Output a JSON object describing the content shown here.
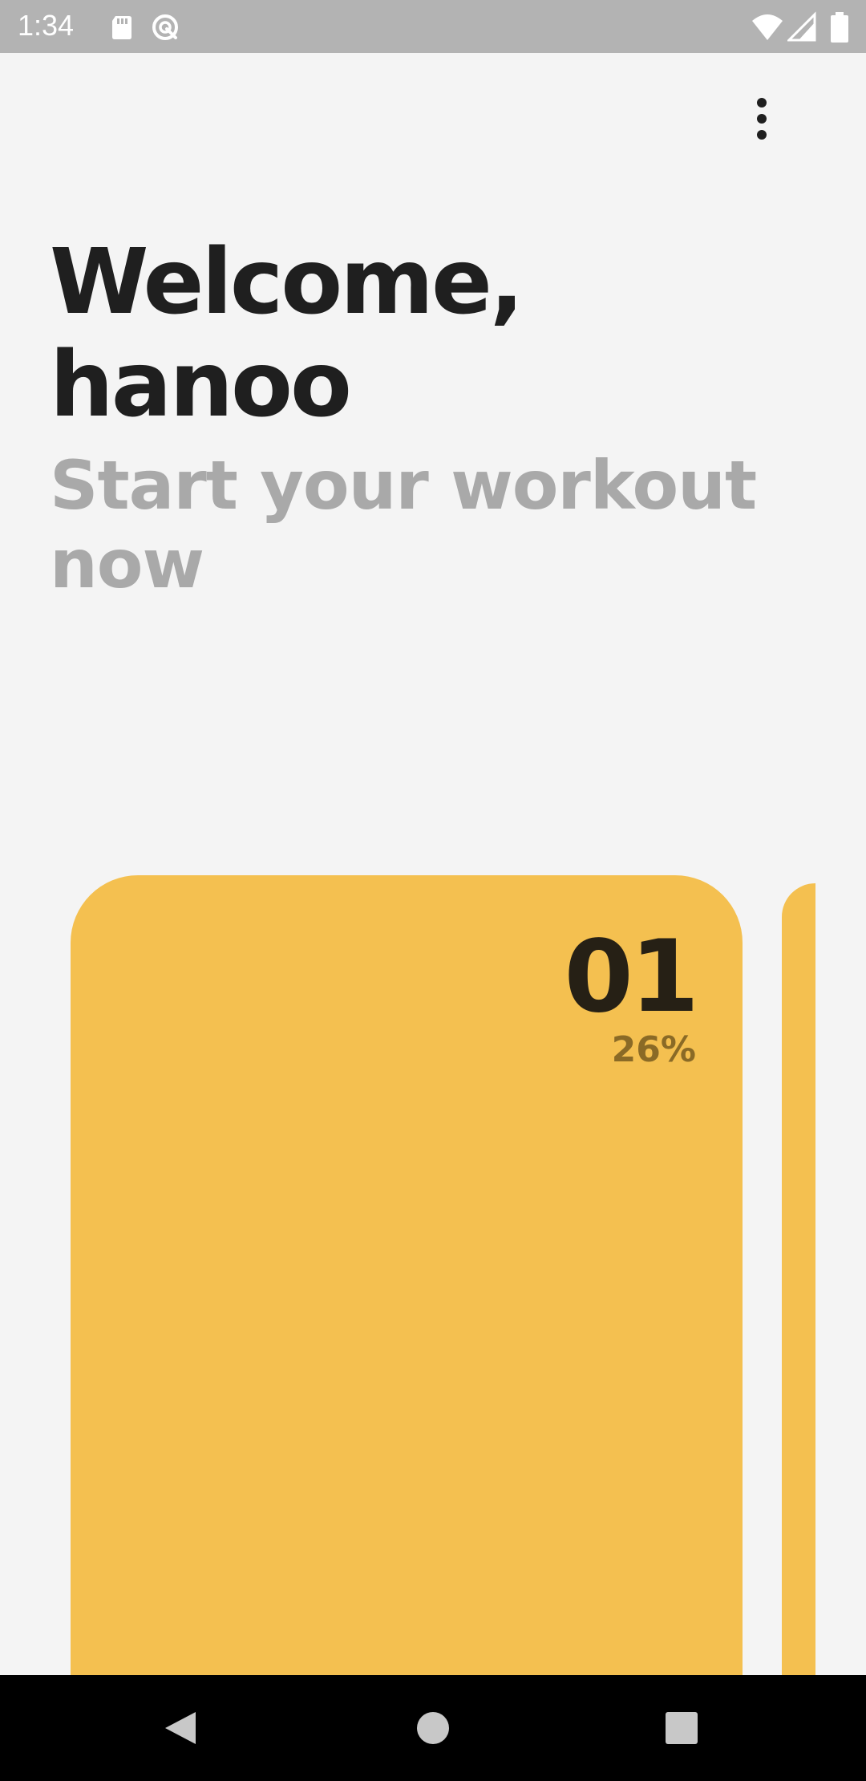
{
  "status_bar": {
    "time": "1:34",
    "background": "#b3b3b3",
    "icons_left": [
      "sd-card-icon",
      "sync-disabled-icon"
    ],
    "icons_right": [
      "wifi-icon",
      "cell-signal-icon",
      "battery-icon"
    ]
  },
  "menu": {
    "icon": "more-vert-icon"
  },
  "header": {
    "welcome": "Welcome, hanoo",
    "subtitle": "Start your workout now"
  },
  "workouts": [
    {
      "number": "01",
      "progress": "26%",
      "color": "#f4c050"
    }
  ],
  "colors": {
    "background": "#f4f4f4",
    "accent": "#f4c050",
    "title": "#1f1f1f",
    "subtitle": "#a9a9a9"
  },
  "nav_bar": {
    "buttons": [
      "back-icon",
      "home-icon",
      "recents-icon"
    ]
  }
}
